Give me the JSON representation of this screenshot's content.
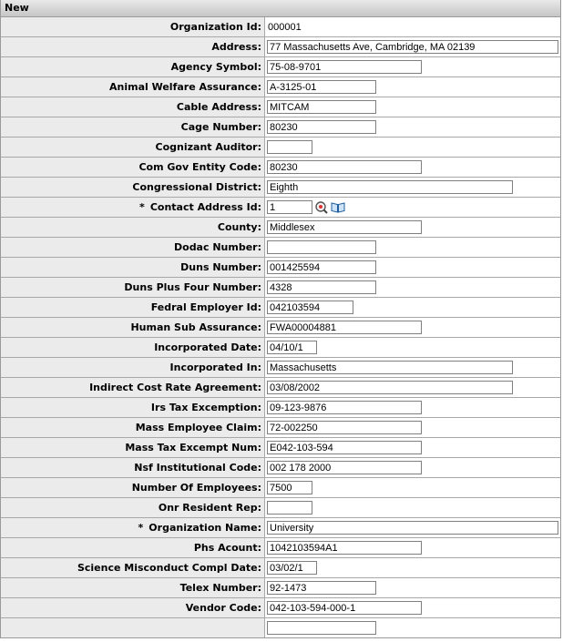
{
  "header": {
    "title": "New"
  },
  "icons": {
    "search": "magnifier-icon",
    "lookup": "book-icon"
  },
  "fields": [
    {
      "label": "Organization Id:",
      "value": "000001",
      "readonly": true
    },
    {
      "label": "Address:",
      "value": "77 Massachusetts Ave, Cambridge, MA 02139"
    },
    {
      "label": "Agency Symbol:",
      "value": "75-08-9701"
    },
    {
      "label": "Animal Welfare Assurance:",
      "value": "A-3125-01"
    },
    {
      "label": "Cable Address:",
      "value": "MITCAM"
    },
    {
      "label": "Cage Number:",
      "value": "80230"
    },
    {
      "label": "Cognizant Auditor:",
      "value": ""
    },
    {
      "label": "Com Gov Entity Code:",
      "value": "80230"
    },
    {
      "label": "Congressional District:",
      "value": "Eighth"
    },
    {
      "label": "Contact Address Id:",
      "value": "1",
      "required": true,
      "required_mark": "*",
      "lookup": true
    },
    {
      "label": "County:",
      "value": "Middlesex"
    },
    {
      "label": "Dodac Number:",
      "value": ""
    },
    {
      "label": "Duns Number:",
      "value": "001425594"
    },
    {
      "label": "Duns Plus Four Number:",
      "value": "4328"
    },
    {
      "label": "Fedral Employer Id:",
      "value": "042103594"
    },
    {
      "label": "Human Sub Assurance:",
      "value": "FWA00004881"
    },
    {
      "label": "Incorporated Date:",
      "value": "04/10/1"
    },
    {
      "label": "Incorporated In:",
      "value": "Massachusetts"
    },
    {
      "label": "Indirect Cost Rate Agreement:",
      "value": "03/08/2002"
    },
    {
      "label": "Irs Tax Excemption:",
      "value": "09-123-9876"
    },
    {
      "label": "Mass Employee Claim:",
      "value": "72-002250"
    },
    {
      "label": "Mass Tax Excempt Num:",
      "value": "E042-103-594"
    },
    {
      "label": "Nsf Institutional Code:",
      "value": "002 178 2000"
    },
    {
      "label": "Number Of Employees:",
      "value": "7500"
    },
    {
      "label": "Onr Resident Rep:",
      "value": ""
    },
    {
      "label": "Organization Name:",
      "value": "University",
      "required": true,
      "required_mark": "*"
    },
    {
      "label": "Phs Acount:",
      "value": "1042103594A1"
    },
    {
      "label": "Science Misconduct Compl Date:",
      "value": "03/02/1"
    },
    {
      "label": "Telex Number:",
      "value": "92-1473"
    },
    {
      "label": "Vendor Code:",
      "value": "042-103-594-000-1"
    },
    {
      "label": "",
      "value": ""
    }
  ]
}
